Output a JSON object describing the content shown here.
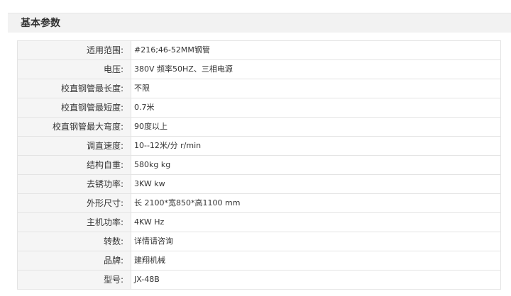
{
  "section": {
    "title": "基本参数"
  },
  "params": [
    {
      "label": "适用范围:",
      "value": "#216;46-52MM钢管"
    },
    {
      "label": "电压:",
      "value": "380V 频率50HZ、三相电源"
    },
    {
      "label": "校直钢管最长度:",
      "value": "不限"
    },
    {
      "label": "校直钢管最短度:",
      "value": "0.7米"
    },
    {
      "label": "校直钢管最大弯度:",
      "value": "90度以上"
    },
    {
      "label": "调直速度:",
      "value": "10--12米/分 r/min"
    },
    {
      "label": "结构自重:",
      "value": "580kg kg"
    },
    {
      "label": "去锈功率:",
      "value": "3KW kw"
    },
    {
      "label": "外形尺寸:",
      "value": "长 2100*宽850*高1100 mm"
    },
    {
      "label": "主机功率:",
      "value": "4KW Hz"
    },
    {
      "label": "转数:",
      "value": "详情请咨询"
    },
    {
      "label": "品牌:",
      "value": "建翔机械"
    },
    {
      "label": "型号:",
      "value": "JX-48B"
    }
  ]
}
